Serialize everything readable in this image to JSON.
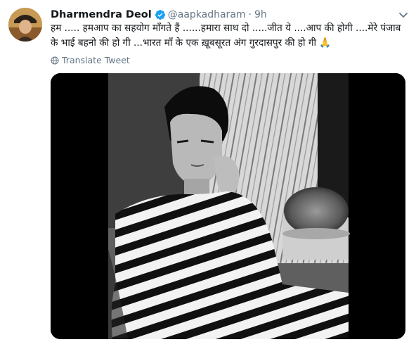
{
  "tweet": {
    "display_name": "Dharmendra Deol",
    "handle": "@aapkadharam",
    "separator": "·",
    "time": "9h",
    "text": "हम ..... हमआप का सहयोग माँगते हैं ......हमारा साथ दो .....जीत ये ....आप की होगी ....मेरे पंजाब के भाई बहनो की हो गी ...भारत माँ के एक ख़ूबसूरत अंग गुरदासपुर की हो गी 🙏",
    "translate_label": "Translate Tweet"
  },
  "icons": {
    "verified": "verified-badge-icon",
    "caret": "chevron-down-icon",
    "translate": "globe-icon"
  },
  "colors": {
    "verified_blue": "#1da1f2",
    "secondary_text": "#657786",
    "primary_text": "#14171a"
  }
}
